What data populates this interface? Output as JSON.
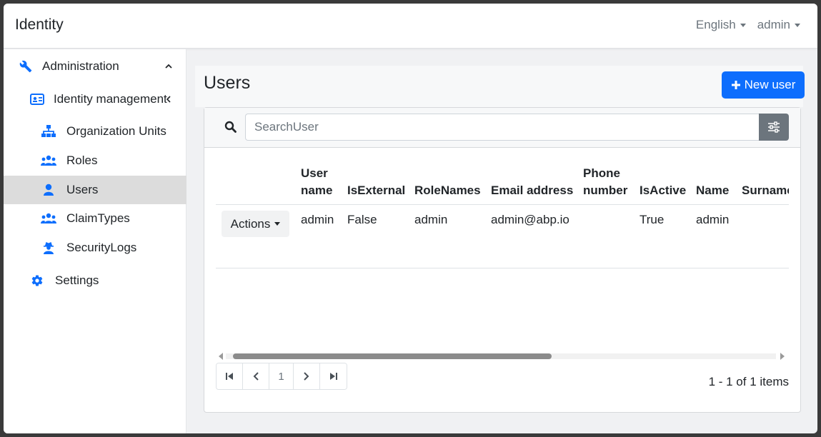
{
  "navbar": {
    "brand": "Identity",
    "language": "English",
    "user": "admin"
  },
  "sidebar": {
    "items": [
      {
        "label": "Administration",
        "icon": "wrench-icon"
      },
      {
        "label": "Identity management",
        "icon": "id-card-icon"
      },
      {
        "label": "Organization Units",
        "icon": "sitemap-icon"
      },
      {
        "label": "Roles",
        "icon": "users-icon"
      },
      {
        "label": "Users",
        "icon": "user-icon",
        "active": true
      },
      {
        "label": "ClaimTypes",
        "icon": "users-icon"
      },
      {
        "label": "SecurityLogs",
        "icon": "user-secret-icon"
      },
      {
        "label": "Settings",
        "icon": "gear-icon"
      }
    ]
  },
  "page": {
    "title": "Users",
    "new_button": "New user"
  },
  "search": {
    "placeholder": "SearchUser"
  },
  "table": {
    "columns": [
      {
        "line1": "User",
        "line2": "name"
      },
      {
        "line1": "",
        "line2": "IsExternal"
      },
      {
        "line1": "",
        "line2": "RoleNames"
      },
      {
        "line1": "",
        "line2": "Email address"
      },
      {
        "line1": "Phone",
        "line2": "number"
      },
      {
        "line1": "",
        "line2": "IsActive"
      },
      {
        "line1": "",
        "line2": "Name"
      },
      {
        "line1": "",
        "line2": "Surname"
      }
    ],
    "rows": [
      {
        "actions_label": "Actions",
        "cells": [
          "admin",
          "False",
          "admin",
          "admin@abp.io",
          "",
          "True",
          "admin",
          ""
        ]
      }
    ]
  },
  "pagination": {
    "current_page": "1",
    "summary": "1 - 1 of 1 items"
  },
  "colors": {
    "primary": "#0d6efd",
    "secondary": "#6c757d",
    "active_item_bg": "#dcdcdc"
  }
}
